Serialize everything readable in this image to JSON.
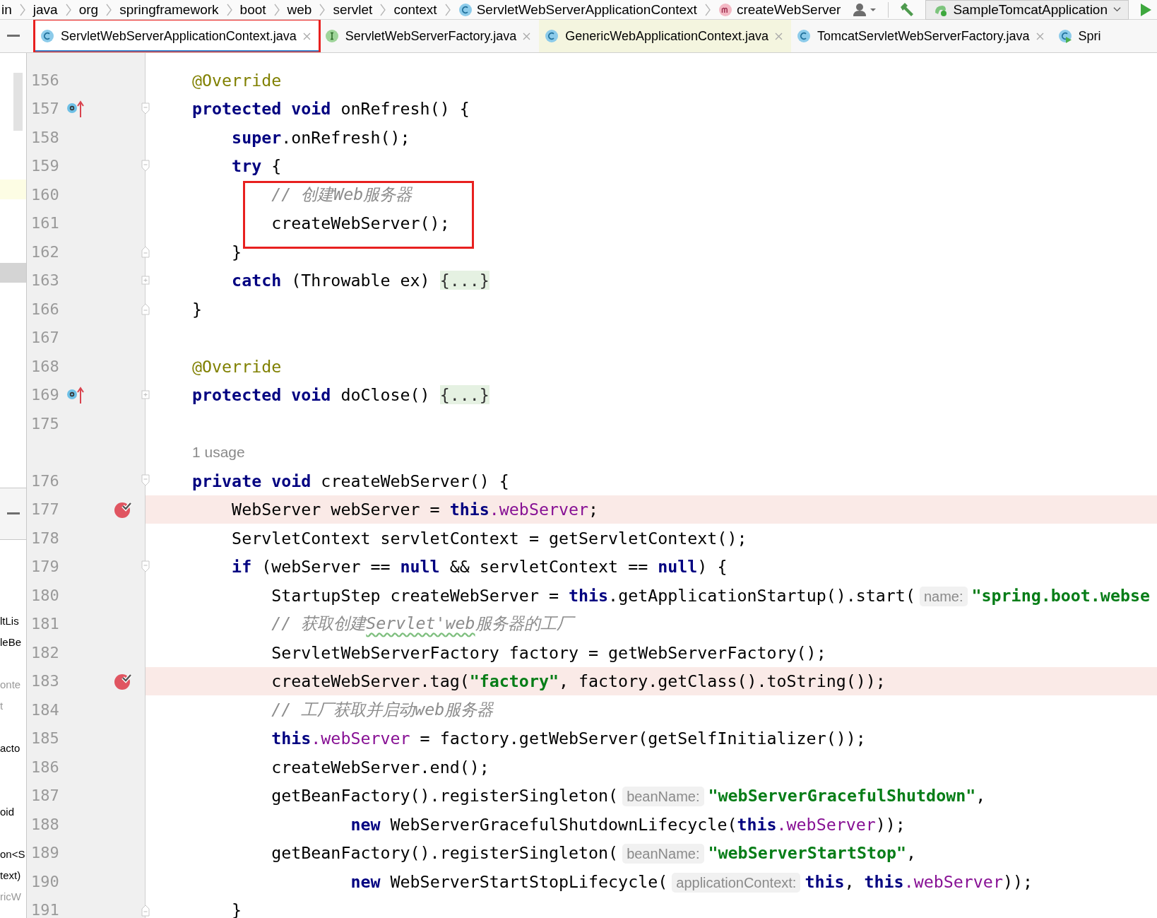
{
  "breadcrumb": [
    {
      "text": "in",
      "kind": "package"
    },
    {
      "text": "java",
      "kind": "package"
    },
    {
      "text": "org",
      "kind": "package"
    },
    {
      "text": "springframework",
      "kind": "package"
    },
    {
      "text": "boot",
      "kind": "package"
    },
    {
      "text": "web",
      "kind": "package"
    },
    {
      "text": "servlet",
      "kind": "package"
    },
    {
      "text": "context",
      "kind": "package"
    },
    {
      "text": "ServletWebServerApplicationContext",
      "kind": "class"
    },
    {
      "text": "createWebServer",
      "kind": "method"
    }
  ],
  "run_config": {
    "label": "SampleTomcatApplication"
  },
  "tabs": [
    {
      "label": "ServletWebServerApplicationContext.java",
      "kind": "class",
      "selected": true,
      "tinted": false,
      "annotated": true,
      "closable": true
    },
    {
      "label": "ServletWebServerFactory.java",
      "kind": "interface",
      "selected": false,
      "tinted": false,
      "annotated": false,
      "closable": true
    },
    {
      "label": "GenericWebApplicationContext.java",
      "kind": "class",
      "selected": false,
      "tinted": true,
      "annotated": false,
      "closable": true
    },
    {
      "label": "TomcatServletWebServerFactory.java",
      "kind": "class",
      "selected": false,
      "tinted": false,
      "annotated": false,
      "closable": true
    },
    {
      "label": "Spri",
      "kind": "runnable",
      "selected": false,
      "tinted": false,
      "annotated": false,
      "closable": false
    }
  ],
  "side_panel": {
    "fragments": [
      {
        "text": "ltLis",
        "dimmed": false
      },
      {
        "text": "leBe",
        "dimmed": false
      },
      {
        "text": "onte",
        "dimmed": true
      },
      {
        "text": "t",
        "dimmed": true
      },
      {
        "text": "acto",
        "dimmed": false
      },
      {
        "text": "oid",
        "dimmed": false
      },
      {
        "text": "on<S",
        "dimmed": false
      },
      {
        "text": "text)",
        "dimmed": false
      },
      {
        "text": "ricW",
        "dimmed": true
      }
    ]
  },
  "lines": [
    {
      "kind": "code",
      "number": "156",
      "overrides": false,
      "breakpoint": false,
      "annotated": false,
      "fold_open": false,
      "fold_close": false,
      "collapsed": false,
      "tokens": [
        {
          "kind": "ann",
          "text": "@Override"
        }
      ]
    },
    {
      "kind": "code",
      "number": "157",
      "overrides": true,
      "breakpoint": false,
      "annotated": false,
      "fold_open": true,
      "fold_close": false,
      "collapsed": false,
      "tokens": [
        {
          "kind": "kw",
          "text": "protected"
        },
        {
          "kind": "kw",
          "text": " void"
        },
        {
          "kind": "plain",
          "text": " onRefresh() {"
        }
      ]
    },
    {
      "kind": "code",
      "number": "158",
      "overrides": false,
      "breakpoint": false,
      "annotated": false,
      "fold_open": false,
      "fold_close": false,
      "collapsed": false,
      "tokens": [
        {
          "kind": "kw",
          "text": "    super"
        },
        {
          "kind": "plain",
          "text": ".onRefresh();"
        }
      ]
    },
    {
      "kind": "code",
      "number": "159",
      "overrides": false,
      "breakpoint": false,
      "annotated": false,
      "fold_open": true,
      "fold_close": false,
      "collapsed": false,
      "tokens": [
        {
          "kind": "kw",
          "text": "    try"
        },
        {
          "kind": "plain",
          "text": " {"
        }
      ]
    },
    {
      "kind": "code",
      "number": "160",
      "overrides": false,
      "breakpoint": false,
      "annotated": true,
      "fold_open": false,
      "fold_close": false,
      "collapsed": false,
      "tokens": [
        {
          "kind": "comment",
          "text": "        // 创建Web服务器"
        }
      ]
    },
    {
      "kind": "code",
      "number": "161",
      "overrides": false,
      "breakpoint": false,
      "annotated": true,
      "fold_open": false,
      "fold_close": false,
      "collapsed": false,
      "tokens": [
        {
          "kind": "plain",
          "text": "        createWebServer();"
        }
      ]
    },
    {
      "kind": "code",
      "number": "162",
      "overrides": false,
      "breakpoint": false,
      "annotated": false,
      "fold_open": false,
      "fold_close": true,
      "collapsed": false,
      "tokens": [
        {
          "kind": "plain",
          "text": "    }"
        }
      ]
    },
    {
      "kind": "code",
      "number": "163",
      "overrides": false,
      "breakpoint": false,
      "annotated": false,
      "fold_open": false,
      "fold_close": false,
      "collapsed": true,
      "tokens": [
        {
          "kind": "kw",
          "text": "    catch"
        },
        {
          "kind": "plain",
          "text": " (Throwable ex) "
        },
        {
          "kind": "fold",
          "text": "{...}"
        }
      ]
    },
    {
      "kind": "code",
      "number": "166",
      "overrides": false,
      "breakpoint": false,
      "annotated": false,
      "fold_open": false,
      "fold_close": true,
      "collapsed": false,
      "tokens": [
        {
          "kind": "plain",
          "text": "}"
        }
      ]
    },
    {
      "kind": "code",
      "number": "167",
      "overrides": false,
      "breakpoint": false,
      "annotated": false,
      "fold_open": false,
      "fold_close": false,
      "collapsed": false
    },
    {
      "kind": "code",
      "number": "168",
      "overrides": false,
      "breakpoint": false,
      "annotated": false,
      "fold_open": false,
      "fold_close": false,
      "collapsed": false,
      "tokens": [
        {
          "kind": "ann",
          "text": "@Override"
        }
      ]
    },
    {
      "kind": "code",
      "number": "169",
      "overrides": true,
      "breakpoint": false,
      "annotated": false,
      "fold_open": false,
      "fold_close": false,
      "collapsed": true,
      "tokens": [
        {
          "kind": "kw",
          "text": "protected"
        },
        {
          "kind": "kw",
          "text": " void"
        },
        {
          "kind": "plain",
          "text": " doClose() "
        },
        {
          "kind": "fold",
          "text": "{...}"
        }
      ]
    },
    {
      "kind": "code",
      "number": "175",
      "overrides": false,
      "breakpoint": false,
      "annotated": false,
      "fold_open": false,
      "fold_close": false,
      "collapsed": false
    },
    {
      "kind": "usage",
      "text": "1 usage",
      "overrides": false,
      "breakpoint": false,
      "annotated": false,
      "fold_open": false,
      "fold_close": false,
      "collapsed": false
    },
    {
      "kind": "code",
      "number": "176",
      "overrides": false,
      "breakpoint": false,
      "annotated": false,
      "fold_open": true,
      "fold_close": false,
      "collapsed": false,
      "tokens": [
        {
          "kind": "kw",
          "text": "private"
        },
        {
          "kind": "kw",
          "text": " void"
        },
        {
          "kind": "plain",
          "text": " createWebServer() {"
        }
      ]
    },
    {
      "kind": "code",
      "number": "177",
      "overrides": false,
      "breakpoint": true,
      "annotated": false,
      "fold_open": false,
      "fold_close": false,
      "collapsed": false,
      "tokens": [
        {
          "kind": "plain",
          "text": "    WebServer webServer = "
        },
        {
          "kind": "kw",
          "text": "this"
        },
        {
          "kind": "field",
          "text": ".webServer"
        },
        {
          "kind": "plain",
          "text": ";"
        }
      ]
    },
    {
      "kind": "code",
      "number": "178",
      "overrides": false,
      "breakpoint": false,
      "annotated": false,
      "fold_open": false,
      "fold_close": false,
      "collapsed": false,
      "tokens": [
        {
          "kind": "plain",
          "text": "    ServletContext servletContext = getServletContext();"
        }
      ]
    },
    {
      "kind": "code",
      "number": "179",
      "overrides": false,
      "breakpoint": false,
      "annotated": false,
      "fold_open": true,
      "fold_close": false,
      "collapsed": false,
      "tokens": [
        {
          "kind": "kw",
          "text": "    if"
        },
        {
          "kind": "plain",
          "text": " (webServer == "
        },
        {
          "kind": "kw",
          "text": "null"
        },
        {
          "kind": "plain",
          "text": " && servletContext == "
        },
        {
          "kind": "kw",
          "text": "null"
        },
        {
          "kind": "plain",
          "text": ") {"
        }
      ]
    },
    {
      "kind": "code",
      "number": "180",
      "overrides": false,
      "breakpoint": false,
      "annotated": false,
      "fold_open": false,
      "fold_close": false,
      "collapsed": false,
      "tokens": [
        {
          "kind": "plain",
          "text": "        StartupStep createWebServer = "
        },
        {
          "kind": "kw",
          "text": "this"
        },
        {
          "kind": "plain",
          "text": ".getApplicationStartup().start("
        },
        {
          "kind": "hint",
          "text": "name:"
        },
        {
          "kind": "str",
          "text": "\"spring.boot.webse"
        }
      ]
    },
    {
      "kind": "code",
      "number": "181",
      "overrides": false,
      "breakpoint": false,
      "annotated": false,
      "fold_open": false,
      "fold_close": false,
      "collapsed": false,
      "tokens": [
        {
          "kind": "comment",
          "text": "        // 获取创建"
        },
        {
          "kind": "typo",
          "text": "Servlet'web"
        },
        {
          "kind": "comment",
          "text": "服务器的工厂"
        }
      ]
    },
    {
      "kind": "code",
      "number": "182",
      "overrides": false,
      "breakpoint": false,
      "annotated": false,
      "fold_open": false,
      "fold_close": false,
      "collapsed": false,
      "tokens": [
        {
          "kind": "plain",
          "text": "        ServletWebServerFactory factory = getWebServerFactory();"
        }
      ]
    },
    {
      "kind": "code",
      "number": "183",
      "overrides": false,
      "breakpoint": true,
      "annotated": false,
      "fold_open": false,
      "fold_close": false,
      "collapsed": false,
      "tokens": [
        {
          "kind": "plain",
          "text": "        createWebServer.tag("
        },
        {
          "kind": "str",
          "text": "\"factory\""
        },
        {
          "kind": "plain",
          "text": ", factory.getClass().toString());"
        }
      ]
    },
    {
      "kind": "code",
      "number": "184",
      "overrides": false,
      "breakpoint": false,
      "annotated": false,
      "fold_open": false,
      "fold_close": false,
      "collapsed": false,
      "tokens": [
        {
          "kind": "comment",
          "text": "        // 工厂获取并启动web服务器"
        }
      ]
    },
    {
      "kind": "code",
      "number": "185",
      "overrides": false,
      "breakpoint": false,
      "annotated": false,
      "fold_open": false,
      "fold_close": false,
      "collapsed": false,
      "tokens": [
        {
          "kind": "kw",
          "text": "        this"
        },
        {
          "kind": "field",
          "text": ".webServer"
        },
        {
          "kind": "plain",
          "text": " = factory.getWebServer(getSelfInitializer());"
        }
      ]
    },
    {
      "kind": "code",
      "number": "186",
      "overrides": false,
      "breakpoint": false,
      "annotated": false,
      "fold_open": false,
      "fold_close": false,
      "collapsed": false,
      "tokens": [
        {
          "kind": "plain",
          "text": "        createWebServer.end();"
        }
      ]
    },
    {
      "kind": "code",
      "number": "187",
      "overrides": false,
      "breakpoint": false,
      "annotated": false,
      "fold_open": false,
      "fold_close": false,
      "collapsed": false,
      "tokens": [
        {
          "kind": "plain",
          "text": "        getBeanFactory().registerSingleton("
        },
        {
          "kind": "hint",
          "text": "beanName:"
        },
        {
          "kind": "str",
          "text": "\"webServerGracefulShutdown\""
        },
        {
          "kind": "plain",
          "text": ","
        }
      ]
    },
    {
      "kind": "code",
      "number": "188",
      "overrides": false,
      "breakpoint": false,
      "annotated": false,
      "fold_open": false,
      "fold_close": false,
      "collapsed": false,
      "tokens": [
        {
          "kind": "kw",
          "text": "                new"
        },
        {
          "kind": "plain",
          "text": " WebServerGracefulShutdownLifecycle("
        },
        {
          "kind": "kw",
          "text": "this"
        },
        {
          "kind": "field",
          "text": ".webServer"
        },
        {
          "kind": "plain",
          "text": "));"
        }
      ]
    },
    {
      "kind": "code",
      "number": "189",
      "overrides": false,
      "breakpoint": false,
      "annotated": false,
      "fold_open": false,
      "fold_close": false,
      "collapsed": false,
      "tokens": [
        {
          "kind": "plain",
          "text": "        getBeanFactory().registerSingleton("
        },
        {
          "kind": "hint",
          "text": "beanName:"
        },
        {
          "kind": "str",
          "text": "\"webServerStartStop\""
        },
        {
          "kind": "plain",
          "text": ","
        }
      ]
    },
    {
      "kind": "code",
      "number": "190",
      "overrides": false,
      "breakpoint": false,
      "annotated": false,
      "fold_open": false,
      "fold_close": false,
      "collapsed": false,
      "tokens": [
        {
          "kind": "kw",
          "text": "                new"
        },
        {
          "kind": "plain",
          "text": " WebServerStartStopLifecycle("
        },
        {
          "kind": "hint",
          "text": "applicationContext:"
        },
        {
          "kind": "kw",
          "text": "this"
        },
        {
          "kind": "plain",
          "text": ", "
        },
        {
          "kind": "kw",
          "text": "this"
        },
        {
          "kind": "field",
          "text": ".webServer"
        },
        {
          "kind": "plain",
          "text": "));"
        }
      ]
    },
    {
      "kind": "code",
      "number": "191",
      "overrides": false,
      "breakpoint": false,
      "annotated": false,
      "fold_open": false,
      "fold_close": true,
      "collapsed": false,
      "tokens": [
        {
          "kind": "plain",
          "text": "    }"
        }
      ]
    }
  ]
}
